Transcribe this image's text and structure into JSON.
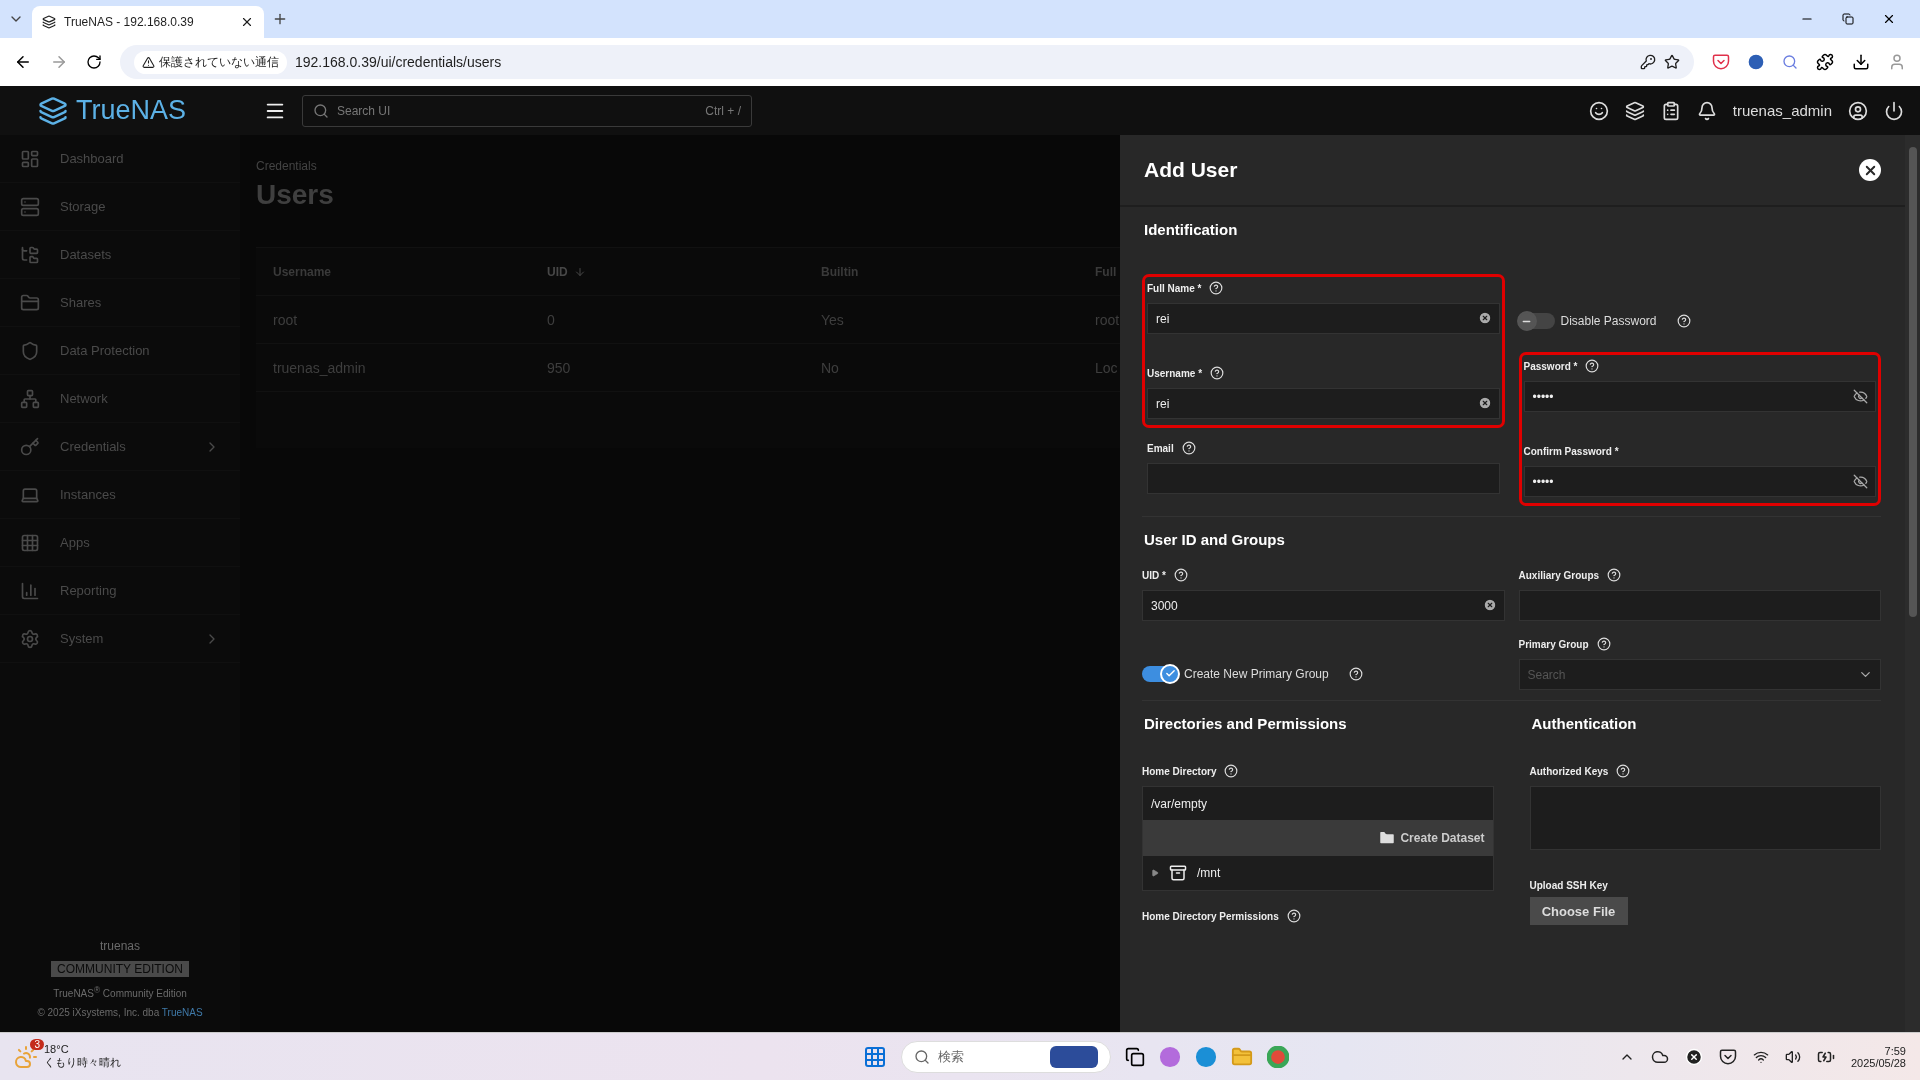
{
  "browser": {
    "tab_title": "TrueNAS - 192.168.0.39",
    "security_label": "保護されていない通信",
    "url": "192.168.0.39/ui/credentials/users"
  },
  "header": {
    "logo": "TrueNAS",
    "search_placeholder": "Search UI",
    "shortcut": "Ctrl + /",
    "username": "truenas_admin"
  },
  "sidebar": {
    "items": [
      {
        "label": "Dashboard",
        "has_submenu": false
      },
      {
        "label": "Storage",
        "has_submenu": false
      },
      {
        "label": "Datasets",
        "has_submenu": false
      },
      {
        "label": "Shares",
        "has_submenu": false
      },
      {
        "label": "Data Protection",
        "has_submenu": false
      },
      {
        "label": "Network",
        "has_submenu": false
      },
      {
        "label": "Credentials",
        "has_submenu": true
      },
      {
        "label": "Instances",
        "has_submenu": false
      },
      {
        "label": "Apps",
        "has_submenu": false
      },
      {
        "label": "Reporting",
        "has_submenu": false
      },
      {
        "label": "System",
        "has_submenu": true
      }
    ],
    "footer": {
      "hostname": "truenas",
      "edition_badge": "COMMUNITY EDITION",
      "product": "TrueNAS$^{®}$ Community Edition",
      "copyright": "© 2025 iXsystems, Inc. dba",
      "copyright_link": "TrueNAS"
    }
  },
  "page": {
    "breadcrumb": "Credentials",
    "title": "Users",
    "table": {
      "columns": [
        {
          "label": "Username",
          "sorted": false
        },
        {
          "label": "UID",
          "sorted": true
        },
        {
          "label": "Builtin",
          "sorted": false
        },
        {
          "label": "Full",
          "sorted": false
        }
      ],
      "rows": [
        [
          "root",
          "0",
          "Yes",
          "root"
        ],
        [
          "truenas_admin",
          "950",
          "No",
          "Loc"
        ]
      ]
    }
  },
  "drawer": {
    "title": "Add User",
    "identification": {
      "heading": "Identification",
      "left_groups": [
        {
          "highlighted": true,
          "fields": [
            {
              "kind": "text",
              "label": "Full Name *",
              "help": true,
              "value": "rei",
              "clearable": true
            },
            {
              "kind": "text",
              "label": "Username *",
              "help": true,
              "value": "rei",
              "clearable": true
            }
          ]
        },
        {
          "highlighted": false,
          "fields": [
            {
              "kind": "text",
              "label": "Email",
              "help": true,
              "clearable": false
            }
          ]
        }
      ],
      "disable_password": {
        "label": "Disable Password",
        "on": false,
        "help": true
      },
      "password_group": {
        "highlighted": true,
        "fields": [
          {
            "kind": "password",
            "label": "Password *",
            "help": true,
            "value": "•••••"
          },
          {
            "kind": "password",
            "label": "Confirm Password *",
            "help": false,
            "value": "•••••"
          }
        ]
      }
    },
    "user_id_groups": {
      "heading": "User ID and Groups",
      "uid": {
        "kind": "text",
        "label": "UID *",
        "help": true,
        "value": "3000",
        "clearable": true
      },
      "auxiliary_groups": {
        "kind": "text",
        "label": "Auxiliary Groups",
        "help": true,
        "clearable": false
      },
      "create_primary_group": {
        "label": "Create New Primary Group",
        "on": true,
        "help": true
      },
      "primary_group": {
        "kind": "select",
        "label": "Primary Group",
        "help": true,
        "placeholder": "Search"
      }
    },
    "directories": {
      "heading": "Directories and Permissions",
      "home_directory": {
        "label": "Home Directory",
        "help": true,
        "value": "/var/empty"
      },
      "create_dataset": "Create Dataset",
      "tree": [
        {
          "label": "/mnt",
          "expanded": false
        }
      ],
      "permissions_label": "Home Directory Permissions",
      "permissions_help": true
    },
    "authentication": {
      "heading": "Authentication",
      "authorized_keys": {
        "label": "Authorized Keys",
        "help": true
      },
      "upload_label": "Upload SSH Key",
      "choose_file": "Choose File"
    }
  },
  "taskbar": {
    "weather_badge": "3",
    "temperature": "18°C",
    "weather": "くもり時々晴れ",
    "search_placeholder": "検索",
    "time": "7:59",
    "date": "2025/05/28"
  }
}
